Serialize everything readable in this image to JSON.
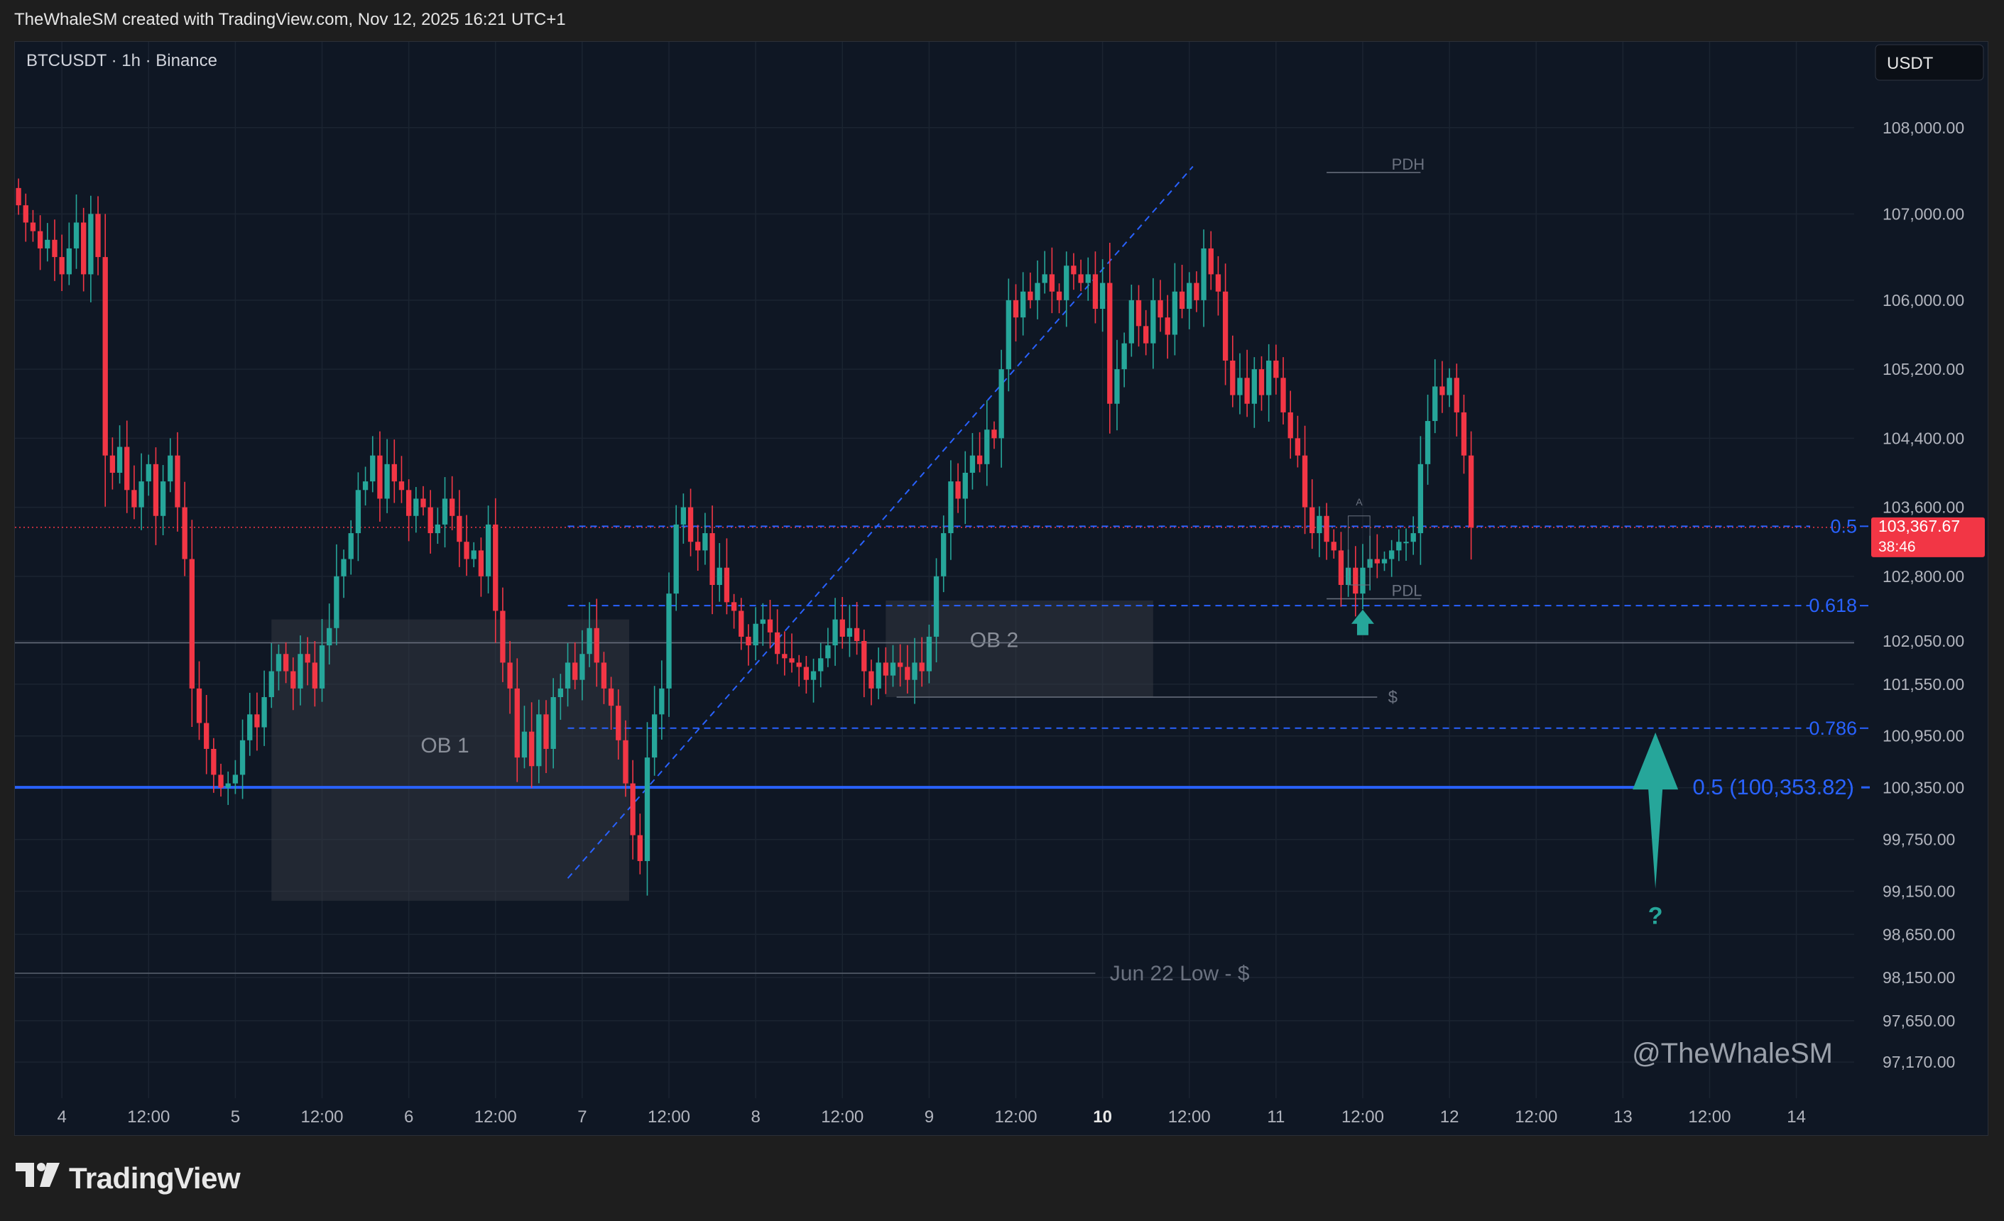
{
  "header": {
    "attribution": "TheWhaleSM created with TradingView.com, Nov 12, 2025 16:21 UTC+1"
  },
  "symbol_label": "BTCUSDT · 1h · Binance",
  "currency_button": "USDT",
  "watermark": "@TheWhaleSM",
  "footer": {
    "brand": "TradingView",
    "logo_icon": "tradingview-logo-icon"
  },
  "colors": {
    "up": "#26a69a",
    "down": "#f23645",
    "fib": "#2962ff",
    "background": "#0f1724"
  },
  "chart_data": {
    "type": "candlestick",
    "symbol": "BTCUSDT",
    "timeframe": "1h",
    "exchange": "Binance",
    "ylim": [
      96900,
      108500
    ],
    "y_ticks": [
      "108,000.00",
      "107,000.00",
      "106,000.00",
      "105,200.00",
      "104,400.00",
      "103,600.00",
      "102,800.00",
      "102,050.00",
      "101,550.00",
      "100,950.00",
      "100,350.00",
      "99,750.00",
      "99,150.00",
      "98,650.00",
      "98,150.00",
      "97,650.00",
      "97,170.00"
    ],
    "y_tick_values": [
      108000,
      107000,
      106000,
      105200,
      104400,
      103600,
      102800,
      102050,
      101550,
      100950,
      100350,
      99750,
      99150,
      98650,
      98150,
      97650,
      97170
    ],
    "x_ticks": [
      "4",
      "12:00",
      "5",
      "12:00",
      "6",
      "12:00",
      "7",
      "12:00",
      "8",
      "12:00",
      "9",
      "12:00",
      "10",
      "12:00",
      "11",
      "12:00",
      "12",
      "12:00",
      "13",
      "12:00",
      "14"
    ],
    "x_tick_values": [
      -8,
      4,
      16,
      28,
      40,
      52,
      64,
      76,
      88,
      100,
      112,
      124,
      136,
      148,
      160,
      172,
      184,
      196,
      208,
      220,
      232
    ],
    "bold_x_tick": "10",
    "x_range": [
      -14.5,
      240
    ],
    "last_price": {
      "value": 103367.67,
      "label": "103,367.67",
      "countdown": "38:46"
    },
    "closes": [
      107100,
      106900,
      106800,
      106600,
      106700,
      106500,
      106300,
      106600,
      106900,
      106300,
      107000,
      106500,
      104200,
      104000,
      104300,
      103800,
      103600,
      103900,
      104100,
      103500,
      103900,
      104200,
      103600,
      103000,
      101500,
      101100,
      100800,
      100500,
      100350,
      100400,
      100500,
      100900,
      101200,
      101050,
      101400,
      101700,
      101900,
      101700,
      101500,
      101900,
      101800,
      101500,
      102000,
      102200,
      102800,
      103000,
      103300,
      103800,
      103900,
      104200,
      103700,
      104100,
      103900,
      103800,
      103500,
      103700,
      103600,
      103300,
      103400,
      103700,
      103500,
      103200,
      103000,
      103100,
      102800,
      103400,
      102400,
      101800,
      101500,
      100700,
      101000,
      100600,
      101200,
      100800,
      101400,
      101500,
      101800,
      101600,
      101900,
      102200,
      101800,
      101500,
      101300,
      100900,
      100400,
      99800,
      99500,
      100700,
      101200,
      101500,
      102600,
      103400,
      103600,
      103200,
      103100,
      103300,
      102700,
      102900,
      102500,
      102400,
      102100,
      102000,
      102250,
      102300,
      102150,
      101900,
      101850,
      101800,
      101750,
      101600,
      101700,
      101850,
      102000,
      102300,
      102100,
      102200,
      102050,
      101700,
      101500,
      101800,
      101650,
      101800,
      101750,
      101600,
      101800,
      101700,
      102100,
      102800,
      103300,
      103900,
      103700,
      104000,
      104200,
      104100,
      104500,
      104400,
      105200,
      106000,
      105800,
      106100,
      106000,
      106200,
      106300,
      106100,
      106000,
      106400,
      106300,
      106200,
      106300,
      105900,
      106200,
      104800,
      105200,
      105500,
      106000,
      105700,
      105500,
      106000,
      105800,
      105600,
      106100,
      105900,
      106200,
      106000,
      106600,
      106300,
      106100,
      105300,
      104900,
      105100,
      104800,
      105200,
      104900,
      105300,
      105100,
      104700,
      104400,
      104200,
      103600,
      103300,
      103500,
      103200,
      103100,
      102700,
      102900,
      102600,
      102900,
      103000,
      102950,
      103000,
      103100,
      103200,
      103200,
      103300,
      104100,
      104600,
      105000,
      104900,
      105100,
      104700,
      104200,
      103367.67
    ],
    "candle_interval": "1h",
    "annotations": {
      "fib_levels": [
        {
          "label": "0.5",
          "value": 103380
        },
        {
          "label": "0.618",
          "value": 102460
        },
        {
          "label": "0.786",
          "value": 101040
        },
        {
          "label": "0.5 (100,353.82)",
          "value": 100353.82
        }
      ],
      "order_blocks": [
        {
          "label": "OB 1",
          "top": 102300,
          "bottom": 99040
        },
        {
          "label": "OB 2",
          "top": 102520,
          "bottom": 101400
        }
      ],
      "levels": [
        {
          "label": "PDH",
          "value": 107480
        },
        {
          "label": "PDL",
          "value": 102540
        },
        {
          "label": "$",
          "value": 101400
        },
        {
          "label": "Jun 22 Low - $",
          "value": 98200
        }
      ],
      "small_marker": "A",
      "question_mark": "?",
      "arrow_up_icon": "arrow-up-icon"
    }
  }
}
